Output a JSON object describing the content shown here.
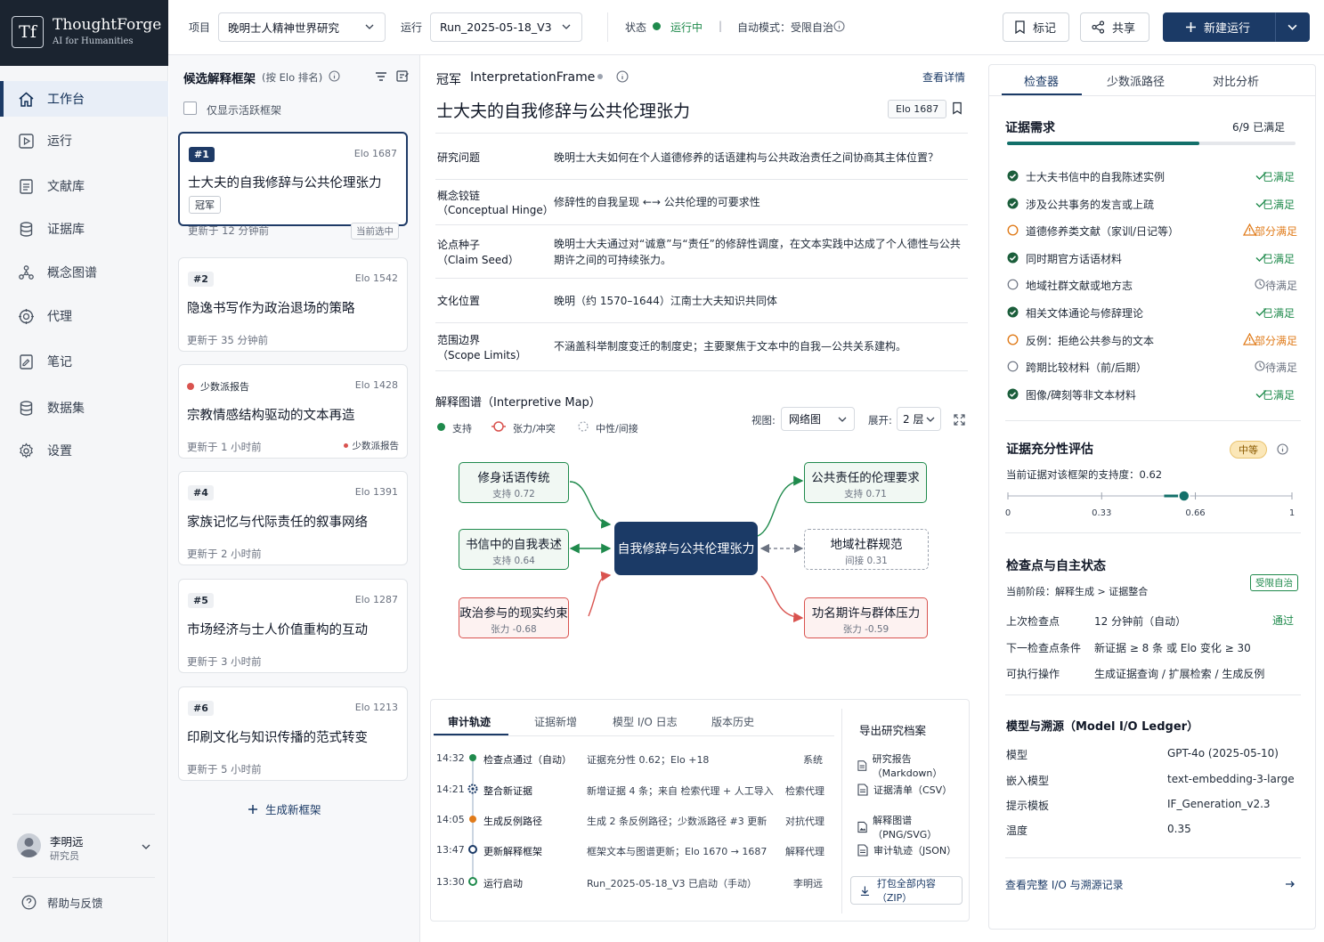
{
  "brand": {
    "logo_glyph": "Tf",
    "name": "ThoughtForge",
    "tagline": "AI for Humanities"
  },
  "topbar": {
    "project_label": "项目",
    "project_value": "晚明士人精神世界研究",
    "run_label": "运行",
    "run_value": "Run_2025-05-18_V3",
    "status_label": "状态",
    "status_value": "运行中",
    "separator": "|",
    "auto_mode": "自动模式：受限自治",
    "mark_label": "标记",
    "share_label": "共享",
    "new_run_label": "新建运行"
  },
  "sidebar": {
    "items": [
      {
        "label": "工作台",
        "icon": "home-icon"
      },
      {
        "label": "运行",
        "icon": "play-icon"
      },
      {
        "label": "文献库",
        "icon": "document-icon"
      },
      {
        "label": "证据库",
        "icon": "database-icon"
      },
      {
        "label": "概念图谱",
        "icon": "graph-icon"
      },
      {
        "label": "代理",
        "icon": "agent-icon"
      },
      {
        "label": "笔记",
        "icon": "notes-icon"
      },
      {
        "label": "数据集",
        "icon": "dataset-icon"
      },
      {
        "label": "设置",
        "icon": "gear-icon"
      }
    ],
    "user_name": "李明远",
    "user_role": "研究员",
    "help_label": "帮助与反馈"
  },
  "candidates": {
    "title": "候选解释框架",
    "subtitle": "(按 Elo 排名)",
    "active_only_label": "仅显示活跃框架",
    "cards": [
      {
        "rank": "#1",
        "elo": "Elo 1687",
        "title": "士大夫的自我修辞与公共伦理张力",
        "tag": "冠军",
        "updated": "更新于 12 分钟前",
        "badge": "当前选中"
      },
      {
        "rank": "#2",
        "elo": "Elo 1542",
        "title": "隐逸书写作为政治退场的策略",
        "updated": "更新于 35 分钟前"
      },
      {
        "rank": "少数派报告",
        "elo": "Elo 1428",
        "title": "宗教情感结构驱动的文本再造",
        "updated": "更新于 1 小时前",
        "badge": "少数派报告"
      },
      {
        "rank": "#4",
        "elo": "Elo 1391",
        "title": "家族记忆与代际责任的叙事网络",
        "updated": "更新于 2 小时前"
      },
      {
        "rank": "#5",
        "elo": "Elo 1287",
        "title": "市场经济与士人价值重构的互动",
        "updated": "更新于 3 小时前"
      },
      {
        "rank": "#6",
        "elo": "Elo 1213",
        "title": "印刷文化与知识传播的范式转变",
        "updated": "更新于 5 小时前"
      }
    ],
    "generate_label": "生成新框架"
  },
  "frame": {
    "crown": "冠军",
    "type": "InterpretationFrame",
    "details_link": "查看详情",
    "title": "士大夫的自我修辞与公共伦理张力",
    "elo": "Elo 1687",
    "props": [
      {
        "key": "研究问题",
        "key2": "",
        "value": "晚明士大夫如何在个人道德修养的话语建构与公共政治责任之间协商其主体位置？",
        "value2": ""
      },
      {
        "key": "概念铰链",
        "key2": "（Conceptual Hinge）",
        "value": "修辞性的自我呈现 ←→ 公共伦理的可要求性",
        "value2": ""
      },
      {
        "key": "论点种子",
        "key2": "（Claim Seed）",
        "value": "晚明士大夫通过对“诚意”与“责任”的修辞性调度，在文本实践中达成了个人德性与公共",
        "value2": "期许之间的可持续张力。"
      },
      {
        "key": "文化位置",
        "key2": "",
        "value": "晚明（约 1570–1644）江南士大夫知识共同体",
        "value2": ""
      },
      {
        "key": "范围边界",
        "key2": "（Scope Limits）",
        "value": "不涵盖科举制度变迁的制度史；主要聚焦于文本中的自我—公共关系建构。",
        "value2": ""
      }
    ],
    "map": {
      "title": "解释图谱（Interpretive Map）",
      "legend": [
        "支持",
        "张力/冲突",
        "中性/间接"
      ],
      "view_label": "视图:",
      "view_value": "网络图",
      "expand_label": "展开:",
      "expand_value": "2 层",
      "center": "自我修辞与公共伦理张力",
      "nodes": [
        {
          "title": "修身话语传统",
          "score": "支持 0.72"
        },
        {
          "title": "书信中的自我表述",
          "score": "支持 0.64"
        },
        {
          "title": "政治参与的现实约束",
          "score": "张力 -0.68"
        },
        {
          "title": "公共责任的伦理要求",
          "score": "支持 0.71"
        },
        {
          "title": "地域社群规范",
          "score": "间接 0.31"
        },
        {
          "title": "功名期许与群体压力",
          "score": "张力 -0.59"
        }
      ]
    }
  },
  "audit": {
    "tabs": [
      "审计轨迹",
      "证据新增",
      "模型 I/O 日志",
      "版本历史"
    ],
    "rows": [
      {
        "time": "14:32",
        "event": "检查点通过（自动）",
        "detail": "证据充分性 0.62；Elo +18",
        "actor": "系统"
      },
      {
        "time": "14:21",
        "event": "整合新证据",
        "detail": "新增证据 4 条；来自 检索代理 + 人工导入",
        "actor": "检索代理"
      },
      {
        "time": "14:05",
        "event": "生成反例路径",
        "detail": "生成 2 条反例路径；少数派路径 #3 更新",
        "actor": "对抗代理"
      },
      {
        "time": "13:47",
        "event": "更新解释框架",
        "detail": "框架文本与图谱更新；Elo 1670 → 1687",
        "actor": "解释代理"
      },
      {
        "time": "13:30",
        "event": "运行启动",
        "detail": "Run_2025-05-18_V3 已启动（手动）",
        "actor": "李明远"
      }
    ],
    "export_title": "导出研究档案",
    "exports": [
      "研究报告（Markdown）",
      "证据清单（CSV）",
      "解释图谱（PNG/SVG）",
      "审计轨迹（JSON）"
    ],
    "zip_label": "打包全部内容（ZIP）"
  },
  "inspector": {
    "tabs": [
      "检查器",
      "少数派路径",
      "对比分析"
    ],
    "req_title": "证据需求",
    "req_count": "6/9 已满足",
    "req_progress": 0.667,
    "requirements": [
      {
        "text": "士大夫书信中的自我陈述实例",
        "status": "已满足",
        "state": "ok"
      },
      {
        "text": "涉及公共事务的发言或上疏",
        "status": "已满足",
        "state": "ok"
      },
      {
        "text": "道德修养类文献（家训/日记等）",
        "status": "部分满足",
        "state": "partial"
      },
      {
        "text": "同时期官方话语材料",
        "status": "已满足",
        "state": "ok"
      },
      {
        "text": "地域社群文献或地方志",
        "status": "待满足",
        "state": "pending"
      },
      {
        "text": "相关文体通论与修辞理论",
        "status": "已满足",
        "state": "ok"
      },
      {
        "text": "反例：拒绝公共参与的文本",
        "status": "部分满足",
        "state": "partial"
      },
      {
        "text": "跨期比较材料（前/后期）",
        "status": "待满足",
        "state": "pending"
      },
      {
        "text": "图像/碑刻等非文本材料",
        "status": "已满足",
        "state": "ok"
      }
    ],
    "suff_title": "证据充分性评估",
    "suff_badge": "中等",
    "suff_text": "当前证据对该框架的支持度：0.62",
    "suff_value": 0.62,
    "suff_ticks": [
      "0",
      "0.33",
      "0.66",
      "1"
    ],
    "cp_title": "检查点与自主状态",
    "cp_badge": "受限自治",
    "cp_stage": "当前阶段：解释生成 > 证据整合",
    "cp_rows": [
      {
        "k": "上次检查点",
        "v": "12 分钟前（自动）",
        "extra": "通过"
      },
      {
        "k": "下一检查点条件",
        "v": "新证据 ≥ 8 条 或 Elo 变化 ≥ 30",
        "extra": ""
      },
      {
        "k": "可执行操作",
        "v": "生成证据查询 / 扩展检索 / 生成反例",
        "extra": ""
      }
    ],
    "model_title": "模型与溯源（Model I/O Ledger）",
    "model_rows": [
      {
        "k": "模型",
        "v": "GPT-4o (2025-05-10)"
      },
      {
        "k": "嵌入模型",
        "v": "text-embedding-3-large"
      },
      {
        "k": "提示模板",
        "v": "IF_Generation_v2.3"
      },
      {
        "k": "温度",
        "v": "0.35"
      }
    ],
    "ledger_link": "查看完整 I/O 与溯源记录"
  },
  "colors": {
    "navy": "#1b3a66",
    "green": "#1f8a4c",
    "red": "#d9534f",
    "orange": "#e07b1a",
    "amber_bg": "#fbe7b8"
  }
}
